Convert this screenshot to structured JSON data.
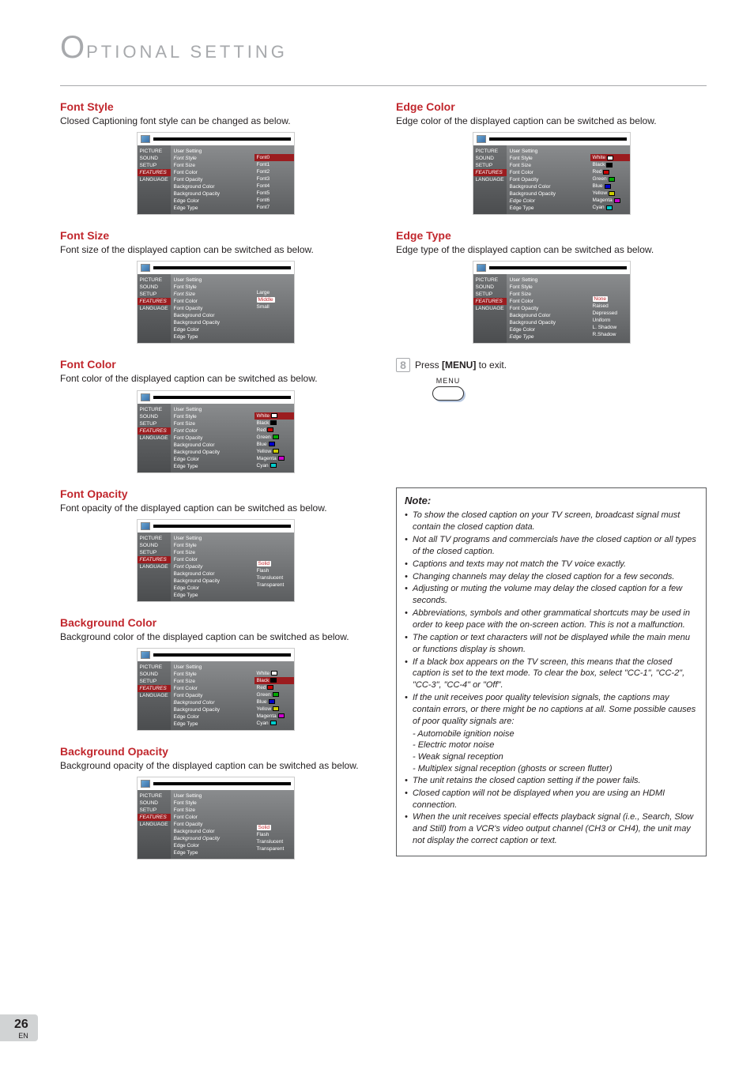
{
  "header": {
    "big": "O",
    "rest": "PTIONAL  SETTING"
  },
  "sidebar": [
    "PICTURE",
    "SOUND",
    "SETUP",
    "FEATURES",
    "LANGUAGE"
  ],
  "settings": [
    "User Setting",
    "Font Style",
    "Font Size",
    "Font Color",
    "Font Opacity",
    "Background Color",
    "Background Opacity",
    "Edge Color",
    "Edge Type"
  ],
  "left": [
    {
      "title": "Font Style",
      "desc": "Closed Captioning font style can be changed as below.",
      "opts": [
        [
          "Font0",
          ""
        ],
        [
          "Font1",
          ""
        ],
        [
          "Font2",
          ""
        ],
        [
          "Font3",
          ""
        ],
        [
          "Font4",
          ""
        ],
        [
          "Font5",
          ""
        ],
        [
          "Font6",
          ""
        ],
        [
          "Font7",
          ""
        ]
      ],
      "activeSetting": 1,
      "sidebarSel": 3,
      "firstActive": true,
      "swatches": false
    },
    {
      "title": "Font Size",
      "desc": "Font size of the displayed caption can be switched as below.",
      "opts": [
        [
          "Large",
          ""
        ],
        [
          "Middle",
          "active"
        ],
        [
          "Small",
          ""
        ]
      ],
      "activeSetting": 2,
      "sidebarSel": 3,
      "swatches": false
    },
    {
      "title": "Font Color",
      "desc": "Font color of the displayed caption can be switched as below.",
      "opts": [
        [
          "White",
          "#fff"
        ],
        [
          "Black",
          "#000"
        ],
        [
          "Red",
          "#c00"
        ],
        [
          "Green",
          "#0a0"
        ],
        [
          "Blue",
          "#00c"
        ],
        [
          "Yellow",
          "#cc0"
        ],
        [
          "Magenta",
          "#c0c"
        ],
        [
          "Cyan",
          "#0cc"
        ]
      ],
      "activeSetting": 3,
      "sidebarSel": 3,
      "firstActive": true,
      "swatches": true
    },
    {
      "title": "Font Opacity",
      "desc": "Font opacity of the displayed caption can be switched as below.",
      "opts": [
        [
          "Solid",
          "active"
        ],
        [
          "Flash",
          ""
        ],
        [
          "Translucent",
          ""
        ],
        [
          "Transparent",
          ""
        ]
      ],
      "activeSetting": 4,
      "sidebarSel": 3,
      "swatches": false
    },
    {
      "title": "Background Color",
      "desc": "Background color of the displayed caption can be switched as below.",
      "opts": [
        [
          "White",
          "#fff"
        ],
        [
          "Black",
          "#000"
        ],
        [
          "Red",
          "#c00"
        ],
        [
          "Green",
          "#0a0"
        ],
        [
          "Blue",
          "#00c"
        ],
        [
          "Yellow",
          "#cc0"
        ],
        [
          "Magenta",
          "#c0c"
        ],
        [
          "Cyan",
          "#0cc"
        ]
      ],
      "activeSetting": 5,
      "sidebarSel": 3,
      "secondActive": true,
      "swatches": true
    },
    {
      "title": "Background Opacity",
      "desc": "Background opacity of the displayed caption can be switched as below.",
      "opts": [
        [
          "Solid",
          "active"
        ],
        [
          "Flash",
          ""
        ],
        [
          "Translucent",
          ""
        ],
        [
          "Transparent",
          ""
        ]
      ],
      "activeSetting": 6,
      "sidebarSel": 3,
      "swatches": false
    }
  ],
  "right": [
    {
      "title": "Edge Color",
      "desc": "Edge color of the displayed caption can be switched as below.",
      "opts": [
        [
          "White",
          "#fff"
        ],
        [
          "Black",
          "#000"
        ],
        [
          "Red",
          "#c00"
        ],
        [
          "Green",
          "#0a0"
        ],
        [
          "Blue",
          "#00c"
        ],
        [
          "Yellow",
          "#cc0"
        ],
        [
          "Magenta",
          "#c0c"
        ],
        [
          "Cyan",
          "#0cc"
        ]
      ],
      "activeSetting": 7,
      "sidebarSel": 3,
      "firstActive": true,
      "swatches": true
    },
    {
      "title": "Edge Type",
      "desc": "Edge type of the displayed caption can be switched as below.",
      "opts": [
        [
          "None",
          "active"
        ],
        [
          "Raised",
          ""
        ],
        [
          "Depressed",
          ""
        ],
        [
          "Uniform",
          ""
        ],
        [
          "L. Shadow",
          ""
        ],
        [
          "R.Shadow",
          ""
        ]
      ],
      "activeSetting": 8,
      "sidebarSel": 3,
      "swatches": false
    }
  ],
  "step8": {
    "num": "8",
    "pre": "Press ",
    "bold": "[MENU]",
    "post": " to exit."
  },
  "menuBtn": "MENU",
  "note": {
    "title": "Note:",
    "items": [
      "To show the closed caption on your TV screen, broadcast signal must contain the closed caption data.",
      "Not all TV programs and commercials have the closed caption or all types of the closed caption.",
      "Captions and texts may not match the TV voice exactly.",
      "Changing channels may delay the closed caption for a few seconds.",
      "Adjusting or muting the volume may delay the closed caption for a few seconds.",
      "Abbreviations, symbols and other grammatical shortcuts may be used in order to keep pace with the on-screen action. This is not a malfunction.",
      "The caption or text characters will not be displayed while the main menu or functions display is shown.",
      "If a black box appears on the TV screen, this means that the closed caption is set to the text mode. To clear the box, select \"CC-1\", \"CC-2\", \"CC-3\", \"CC-4\" or \"Off\".",
      "If the unit receives poor quality television signals, the captions may contain errors, or there might be no captions at all. Some possible causes of poor quality signals are:"
    ],
    "subs": [
      "- Automobile ignition noise",
      "- Electric motor noise",
      "- Weak signal reception",
      "- Multiplex signal reception (ghosts or screen flutter)"
    ],
    "items2": [
      "The unit retains the closed caption setting if the power fails.",
      "Closed caption will not be displayed when you are using an HDMI connection.",
      "When the unit receives special effects playback signal (i.e., Search, Slow and Still) from a VCR's video output channel (CH3 or CH4), the unit may not display the correct caption or text."
    ]
  },
  "pageNum": "26",
  "pageLang": "EN"
}
